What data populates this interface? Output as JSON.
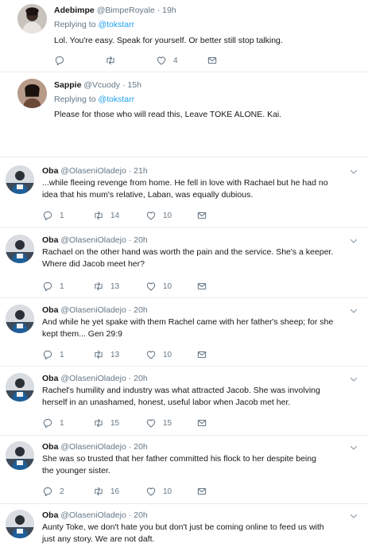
{
  "tweets": [
    {
      "name": "Adebimpe",
      "handle": "@BimpeRoyale",
      "time": "19h",
      "replying_prefix": "Replying to",
      "replying_to": "@tokstarr",
      "text": "Lol. You're easy. Speak for yourself. Or better still stop talking.",
      "replies": "",
      "retweets": "",
      "likes": "4"
    },
    {
      "name": "Sappie",
      "handle": "@Vcuody",
      "time": "15h",
      "replying_prefix": "Replying to",
      "replying_to": "@tokstarr",
      "text": "Please for those who will read this, Leave TOKE ALONE. Kai."
    },
    {
      "name": "Oba",
      "handle": "@OlaseniOladejo",
      "time": "21h",
      "text_lines": [
        "...while fleeing revenge from home. He fell in love with Rachael but he had no",
        "idea that his mum's relative, Laban, was equally dubious."
      ],
      "replies": "1",
      "retweets": "14",
      "likes": "10"
    },
    {
      "name": "Oba",
      "handle": "@OlaseniOladejo",
      "time": "20h",
      "text_lines": [
        "Rachael on the other hand was worth the pain and the service. She's a keeper.",
        "Where did Jacob meet her?"
      ],
      "replies": "1",
      "retweets": "13",
      "likes": "10"
    },
    {
      "name": "Oba",
      "handle": "@OlaseniOladejo",
      "time": "20h",
      "text_lines": [
        "And while he yet spake with them Rachel came with her father's sheep; for she",
        "kept them... Gen 29:9"
      ],
      "replies": "1",
      "retweets": "13",
      "likes": "10"
    },
    {
      "name": "Oba",
      "handle": "@OlaseniOladejo",
      "time": "20h",
      "text_lines": [
        "Rachel's humility and industry was what attracted Jacob. She was involving",
        "herself in an unashamed, honest, useful labor when Jacob met her."
      ],
      "replies": "1",
      "retweets": "15",
      "likes": "15"
    },
    {
      "name": "Oba",
      "handle": "@OlaseniOladejo",
      "time": "20h",
      "text_lines": [
        "She was so trusted that her father committed his flock to her despite being",
        "the younger sister."
      ],
      "replies": "2",
      "retweets": "16",
      "likes": "10"
    },
    {
      "name": "Oba",
      "handle": "@OlaseniOladejo",
      "time": "20h",
      "text_lines": [
        "Aunty Toke, we don't hate you but don't just be coming online to feed us with",
        "just any story. We are not daft."
      ]
    }
  ],
  "icons": {
    "reply": "reply-icon",
    "retweet": "retweet-icon",
    "like": "heart-icon",
    "dm": "envelope-icon",
    "more": "chevron-down-icon"
  },
  "colors": {
    "link": "#1da1f2",
    "meta": "#657786",
    "text": "#14171a",
    "divider": "#e6ecf0"
  }
}
